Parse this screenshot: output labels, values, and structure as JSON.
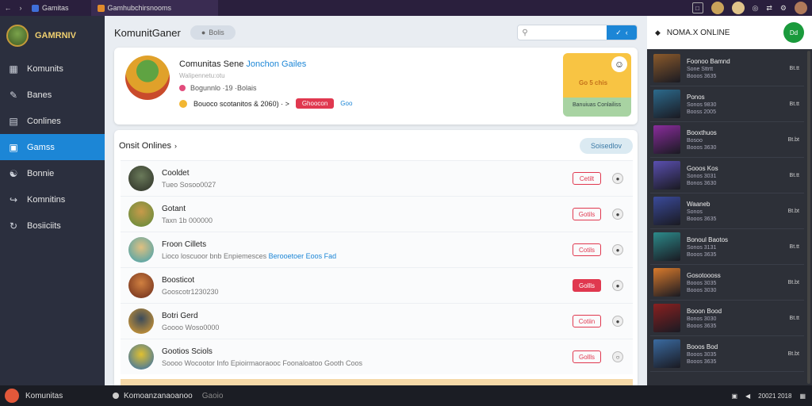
{
  "topbar": {
    "tab1_label": "Gamitas",
    "tab2_label": "Gamhubchirsnooms"
  },
  "sidebar": {
    "brand": "GAMRNIV",
    "items": [
      {
        "label": "Komunits",
        "icon": "grid-icon"
      },
      {
        "label": "Banes",
        "icon": "pen-icon"
      },
      {
        "label": "Conlines",
        "icon": "list-icon"
      },
      {
        "label": "Gamss",
        "icon": "card-icon",
        "active": true
      },
      {
        "label": "Bonnie",
        "icon": "users-icon"
      },
      {
        "label": "Komnitins",
        "icon": "share-icon"
      },
      {
        "label": "Bosiiciits",
        "icon": "refresh-icon"
      }
    ]
  },
  "main": {
    "title": "KomunitGaner",
    "pill_label": "Bolis",
    "search_placeholder": "",
    "hero": {
      "name": "Comunitas Sene",
      "name_accent": "Jonchon Gailes",
      "subtitle": "Walipennetu:otu",
      "meta": "Bogunnlo  ·19  ·Bolais",
      "stats": "Bouoco scotanitos & 2060) · >",
      "badge": "Ghoocon",
      "link": "Goo",
      "promo_text": "Go 5 chis",
      "promo_footer": "Banuiuas Conlailiss"
    },
    "list": {
      "title": "Onsit Onlines",
      "action": "Soisedlov",
      "rows": [
        {
          "name": "Cooldet",
          "sub": "Tueo  Sosoo0027",
          "btn": "Cetilt",
          "filled": false
        },
        {
          "name": "Gotant",
          "sub": "Taxn 1b 000000",
          "btn": "Gotils",
          "filled": false
        },
        {
          "name": "Froon Cillets",
          "sub": "Lioco  loscuoor bnb Enpiemesces",
          "sub_hl": "Berooetoer",
          "sub_tail": "Eoos Fad",
          "btn": "Cotils",
          "filled": false
        },
        {
          "name": "Boosticot",
          "sub": "Gooscotr1230230",
          "btn": "Gollls",
          "filled": true
        },
        {
          "name": "Botri Gerd",
          "sub": "Goooo   Woso0000",
          "btn": "Cotiin",
          "filled": false
        },
        {
          "name": "Gootios Sciols",
          "sub": "Soooo   Wocootor Info Epioirmaoraooc Foonaloatoo Gooth Coos",
          "btn": "Gollls",
          "filled": false
        }
      ]
    }
  },
  "right": {
    "title": "NOMA.X ONLINE",
    "button": "Dd",
    "friends": [
      {
        "name": "Foonoo Bamnd",
        "sub": "Sone Sttrtt",
        "sub2": "Booos 3635",
        "time": "Bt.tt",
        "color": "#8b5a2b"
      },
      {
        "name": "Ponos",
        "sub": "Sonos 9830",
        "sub2": "Booss 2005",
        "time": "Bt.tt",
        "color": "#2c6a8c"
      },
      {
        "name": "Booxthuos",
        "sub": "Bosoo",
        "sub2": "Booos 3630",
        "time": "Bt.bt",
        "color": "#8a2c9c"
      },
      {
        "name": "Gooos Kos",
        "sub": "Sonos 3031",
        "sub2": "Bonos 3630",
        "time": "Bt.tt",
        "color": "#5a4fb0"
      },
      {
        "name": "Waaneb",
        "sub": "Sonos",
        "sub2": "Booos 3635",
        "time": "Bt.bt",
        "color": "#3a4a9a"
      },
      {
        "name": "Bonoul Baotos",
        "sub": "Sonos 3131",
        "sub2": "Booos 3635",
        "time": "Bt.tt",
        "color": "#2c8a8a"
      },
      {
        "name": "Gosotoooss",
        "sub": "Booos 3035",
        "sub2": "Booos 3030",
        "time": "Bt.bt",
        "color": "#d97a2c"
      },
      {
        "name": "Booon Bood",
        "sub": "Bonos 3030",
        "sub2": "Booos 3635",
        "time": "Bt.tt",
        "color": "#8a2020"
      },
      {
        "name": "Booos Bod",
        "sub": "Booos 3035",
        "sub2": "Booos 3635",
        "time": "Bt.bt",
        "color": "#3a6aa0"
      }
    ]
  },
  "bottombar": {
    "left_label": "Komunitas",
    "mid_label": "Komoanzanaoanoo",
    "mid_tag": "Gaoio",
    "right_label": "20021 2018"
  },
  "colors": {
    "accent": "#1c86d6",
    "danger": "#e0384f",
    "sidebar": "#2b2f3e",
    "online": "#1a9a3c"
  }
}
